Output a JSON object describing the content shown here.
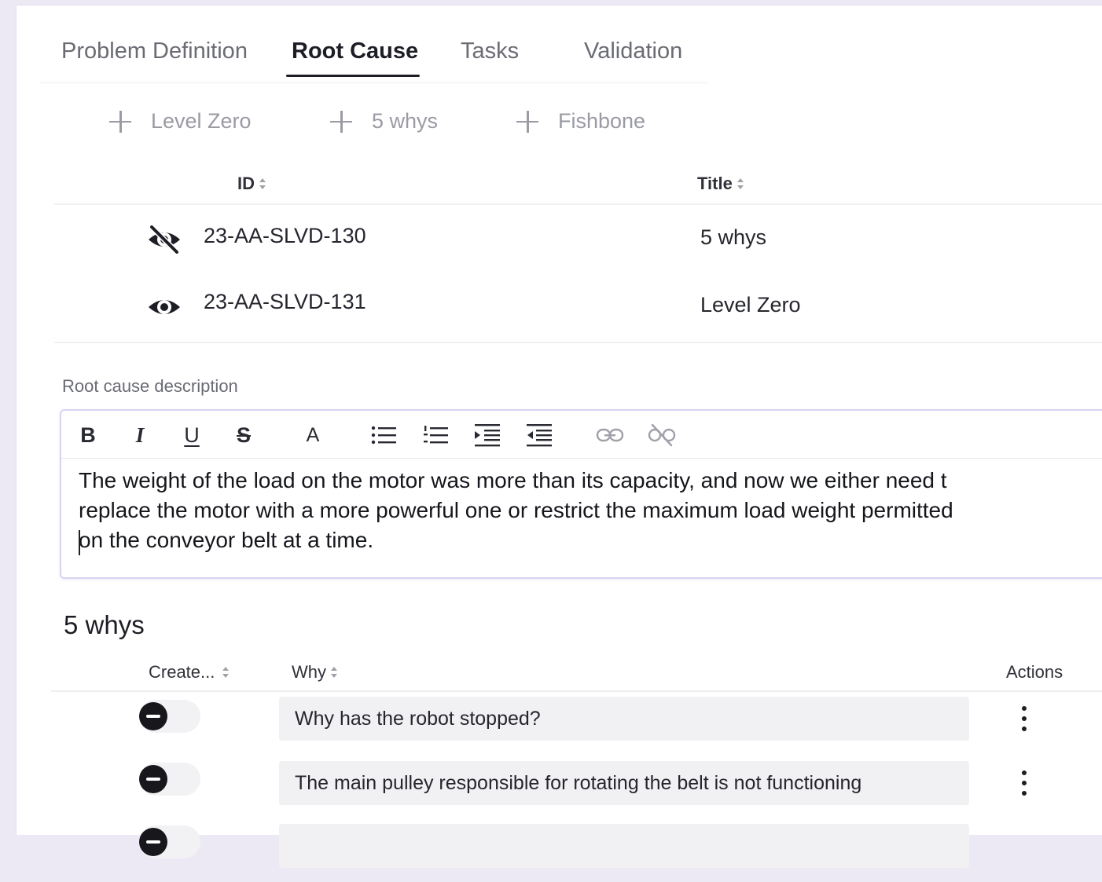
{
  "tabs": [
    {
      "label": "Problem Definition",
      "active": false
    },
    {
      "label": "Root Cause",
      "active": true
    },
    {
      "label": "Tasks",
      "active": false
    },
    {
      "label": "Validation",
      "active": false
    }
  ],
  "add_buttons": [
    {
      "label": "Level Zero",
      "icon": "plus-icon"
    },
    {
      "label": "5 whys",
      "icon": "plus-icon"
    },
    {
      "label": "Fishbone",
      "icon": "plus-icon"
    }
  ],
  "root_causes": {
    "columns": {
      "id": "ID",
      "title": "Title"
    },
    "rows": [
      {
        "visibility_icon": "eye-off-icon",
        "id": "23-AA-SLVD-130",
        "title": "5 whys"
      },
      {
        "visibility_icon": "eye-icon",
        "id": "23-AA-SLVD-131",
        "title": "Level Zero"
      }
    ]
  },
  "description": {
    "label": "Root cause description",
    "toolbar": [
      "bold-icon",
      "italic-icon",
      "underline-icon",
      "strikethrough-icon",
      "font-color-icon",
      "bulleted-list-icon",
      "numbered-list-icon",
      "indent-icon",
      "outdent-icon",
      "link-icon",
      "unlink-icon"
    ],
    "toolbar_glyphs": {
      "bold": "B",
      "italic": "I",
      "underline": "U",
      "strikethrough": "S",
      "font_color": "A"
    },
    "lines": [
      "The weight of the load on the motor was more than its capacity, and now we either need t",
      "replace the motor with a more powerful one or restrict the maximum load weight permitted",
      "on the conveyor belt at a time."
    ]
  },
  "whys": {
    "heading": "5 whys",
    "columns": {
      "created": "Create...",
      "why": "Why",
      "actions": "Actions"
    },
    "rows": [
      {
        "why": "Why has the robot stopped?"
      },
      {
        "why": "The main pulley responsible for rotating the belt is not functioning"
      },
      {
        "why": ""
      }
    ]
  },
  "colors": {
    "accent_border": "#d9d2f1",
    "active_tab": "#1d1e25",
    "muted": "#9a9ba3"
  }
}
